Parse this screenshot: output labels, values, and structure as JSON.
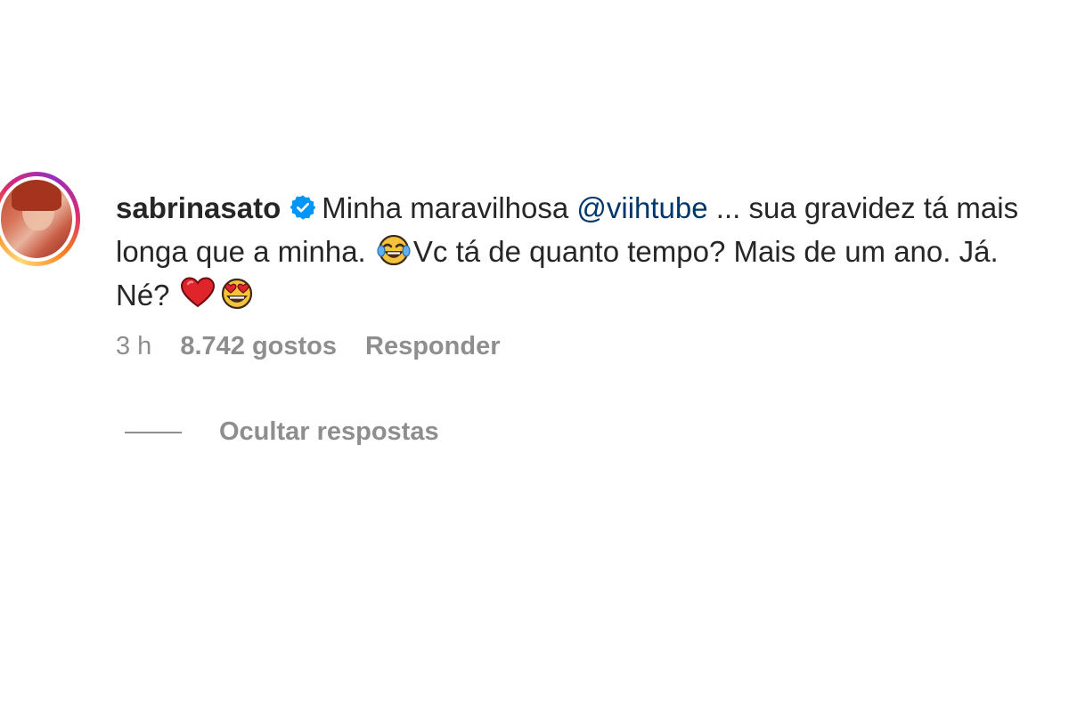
{
  "comment": {
    "username": "sabrinasato",
    "verified_icon": "verified-badge-icon",
    "text_part1": "Minha maravilhosa ",
    "mention": "@viihtube",
    "text_part2": " ... sua gravidez tá mais longa que a minha. ",
    "emoji_laugh": "face-with-tears-of-joy-icon",
    "text_part3": "Vc tá de quanto tempo? Mais de um ano. Já. Né? ",
    "emoji_heart": "red-heart-icon",
    "emoji_heart_eyes": "smiling-face-with-heart-eyes-icon",
    "time": "3 h",
    "likes": "8.742 gostos",
    "reply_label": "Responder"
  },
  "replies": {
    "toggle_label": "Ocultar respostas"
  },
  "colors": {
    "text": "#262626",
    "muted": "#8e8e8e",
    "mention": "#00376b",
    "verified": "#0095f6"
  }
}
